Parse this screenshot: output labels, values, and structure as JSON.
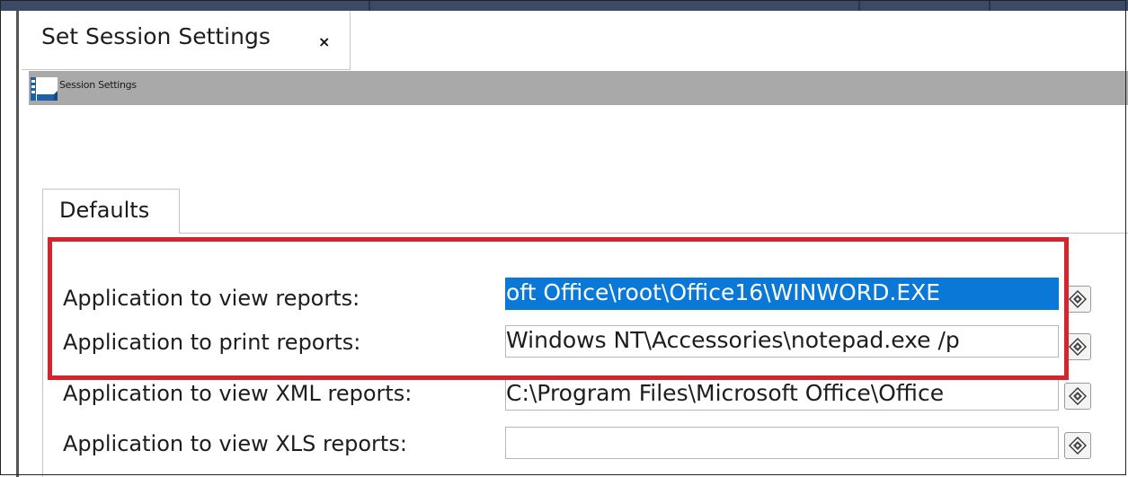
{
  "window": {
    "tab_title": "Set Session Settings",
    "close_glyph": "×"
  },
  "toolbar": {
    "icon": "settings-form-icon",
    "label": "Session Settings"
  },
  "tabs": [
    {
      "label": "Defaults",
      "active": true
    }
  ],
  "fields": [
    {
      "label": "Application to view reports:",
      "value": "oft Office\\root\\Office16\\WINWORD.EXE",
      "selected": true,
      "browse_icon": "browse-diamond-icon"
    },
    {
      "label": "Application to print reports:",
      "value": "Windows NT\\Accessories\\notepad.exe /p",
      "selected": false,
      "browse_icon": "browse-diamond-icon"
    },
    {
      "label": "Application to view XML reports:",
      "value": "C:\\Program Files\\Microsoft Office\\Office",
      "selected": false,
      "browse_icon": "browse-diamond-icon"
    },
    {
      "label": "Application to view XLS reports:",
      "value": "",
      "selected": false,
      "browse_icon": "browse-diamond-icon"
    }
  ],
  "annotation": {
    "highlight_color": "#d7232b"
  },
  "colors": {
    "selection": "#0a78d7",
    "toolbar": "#a9a9a9",
    "top_bar": "#3d4a66"
  }
}
